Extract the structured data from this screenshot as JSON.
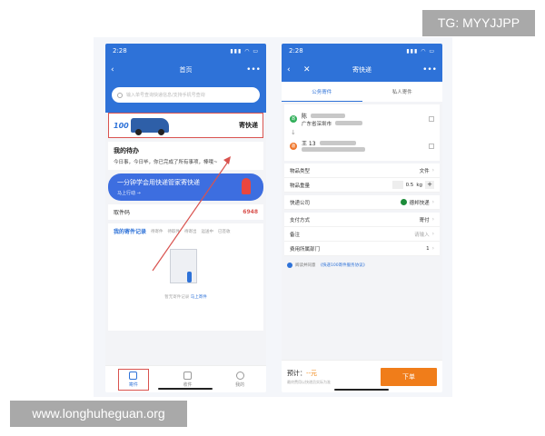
{
  "watermark_top": "TG: MYYJJPP",
  "watermark_bottom": "www.longhuheguan.org",
  "left": {
    "status_time": "2:28",
    "status_icons": "▮▮▮ ◠ ▭",
    "back": "‹",
    "title": "首页",
    "more": "•••",
    "search_placeholder": "输入单号查询快递信息/支持手机号查询",
    "banner_number": "100",
    "banner_label": "寄快递",
    "todo_title": "我的待办",
    "todo_text": "今日事，今日毕，你已完成了所有事项，棒哦~",
    "promo_line1": "一分钟学会用快递管家寄快递",
    "promo_line2": "马上行动 →",
    "pickup_label": "取件码",
    "pickup_code": "6948",
    "records_tabs": [
      "我的寄件记录",
      "待寄件",
      "待取件",
      "待寄出",
      "运送中",
      "已签收"
    ],
    "empty_text": "暂无寄件记录",
    "empty_link": "马上寄件",
    "tabs": [
      "寄件",
      "收件",
      "我的"
    ]
  },
  "right": {
    "status_time": "2:28",
    "status_icons": "▮▮▮ ◠ ▭",
    "back": "‹",
    "close": "✕",
    "title": "寄快递",
    "more": "•••",
    "seg_public": "公务寄件",
    "seg_private": "私人寄件",
    "sender_badge": "寄",
    "sender_name": "陈",
    "sender_addr": "广东省深圳市",
    "receiver_badge": "收",
    "receiver_name": "王 13",
    "rows": {
      "item_type_label": "物品类型",
      "item_type_value": "文件",
      "weight_label": "物品重量",
      "weight_value": "0.5",
      "weight_unit": "kg",
      "company_label": "快递公司",
      "company_value": "德邦快递",
      "payment_label": "支付方式",
      "payment_value": "寄付",
      "remark_label": "备注",
      "remark_placeholder": "请输入",
      "dept_label": "费用所属部门",
      "dept_value": "1"
    },
    "agree_prefix": "阅读并同意",
    "agree_link": "《快递100寄件服务协议》",
    "estimate_label": "预计：",
    "estimate_price": "--元",
    "estimate_note": "最终费用以快递员实际为准",
    "order_button": "下单"
  },
  "colors": {
    "brand_blue": "#2e72d8",
    "highlight_red": "#d9534f",
    "order_orange": "#f07d1a"
  }
}
